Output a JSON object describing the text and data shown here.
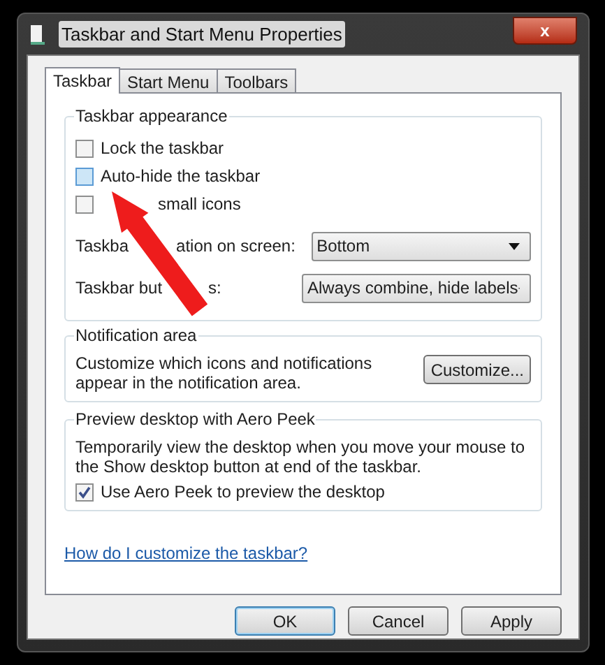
{
  "window": {
    "title": "Taskbar and Start Menu Properties",
    "close": "x"
  },
  "tabs": [
    {
      "label": "Taskbar",
      "selected": true
    },
    {
      "label": "Start Menu",
      "selected": false
    },
    {
      "label": "Toolbars",
      "selected": false
    }
  ],
  "appearance": {
    "title": "Taskbar appearance",
    "checkboxes": [
      {
        "label": "Lock the taskbar",
        "checked": false,
        "hovered": false
      },
      {
        "label": "Auto-hide the taskbar",
        "checked": false,
        "hovered": true
      },
      {
        "label": "small icons",
        "checked": false,
        "hovered": false
      }
    ],
    "dropdowns": [
      {
        "label_parts": [
          "Taskba",
          "ation on screen:"
        ],
        "value": "Bottom"
      },
      {
        "label_parts": [
          "Taskbar but",
          "s:"
        ],
        "value": "Always combine, hide labels"
      }
    ]
  },
  "notification": {
    "title": "Notification area",
    "text": "Customize which icons and notifications appear in the notification area.",
    "button": "Customize..."
  },
  "peek": {
    "title": "Preview desktop with Aero Peek",
    "text": "Temporarily view the desktop when you move your mouse to the Show desktop button at end of the taskbar.",
    "checkbox": {
      "label": "Use Aero Peek to preview the desktop",
      "checked": true,
      "hovered": false
    }
  },
  "help_link": "How do I customize the taskbar?",
  "buttons": [
    {
      "label": "OK",
      "selected": true
    },
    {
      "label": "Cancel",
      "selected": false
    },
    {
      "label": "Apply",
      "selected": false
    }
  ]
}
